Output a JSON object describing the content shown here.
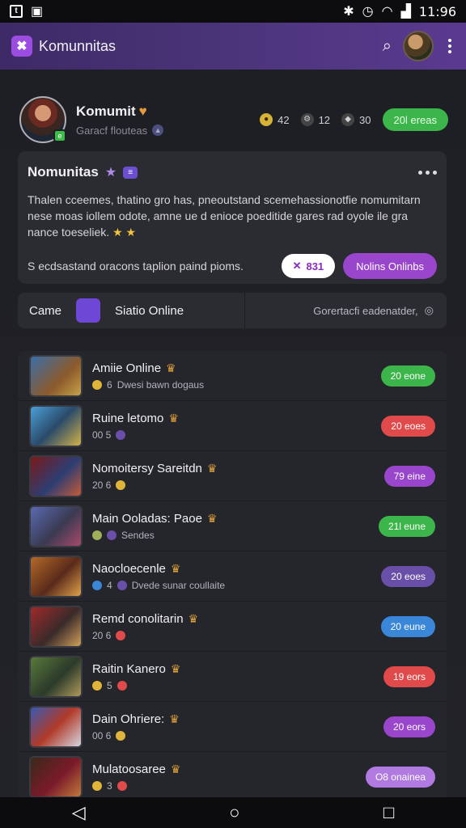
{
  "status_bar": {
    "time": "11:96"
  },
  "app_bar": {
    "title": "Komunnitas",
    "logo_glyph": "✖"
  },
  "profile": {
    "name": "Komumit",
    "subtitle": "Garacf flouteas",
    "stats": [
      "42",
      "12",
      "30"
    ],
    "pill": "20l ereas"
  },
  "card": {
    "title": "Nomunitas",
    "badge": "≡",
    "description": "Thalen cceemes, thatino gro has, pneoutstand scemehassionotfie nomumitarn nese moas iollem odote, amne ue d enioce poeditide gares rad oyole ile gra nance toeseliek.",
    "footer_text": "S ecdsastand oracons taplion paind pioms.",
    "white_pill": "831",
    "purple_pill": "Nolins Onlinbs"
  },
  "filter": {
    "left_label": "Came",
    "mid_label": "Siatio Online",
    "right_label": "Gorertacfi eadenatder,"
  },
  "rows": [
    {
      "title": "Amiie Online",
      "meta_num": "6",
      "meta_text": "Dwesi bawn dogaus",
      "pill": "20 eone",
      "pill_color": "#3cb64a",
      "thumb": "linear-gradient(135deg,#3b6ea8,#8b5a2a 60%,#c7a24a)"
    },
    {
      "title": "Ruine letomo",
      "meta_num": "00 5",
      "meta_text": "",
      "pill": "20 eoes",
      "pill_color": "#e04a4a",
      "thumb": "linear-gradient(135deg,#4aa0d8,#2a4a6a 50%,#d2b24a)"
    },
    {
      "title": "Nomoitersy Sareitdn",
      "meta_num": "20 6",
      "meta_text": "",
      "pill": "79 eine",
      "pill_color": "#9a46cc",
      "thumb": "linear-gradient(135deg,#7a1a1a,#2d3d72 55%,#c45a3a)"
    },
    {
      "title": "Main Ooladas: Paoe",
      "meta_num": "",
      "meta_text": "Sendes",
      "pill": "21l eune",
      "pill_color": "#3cb64a",
      "thumb": "linear-gradient(135deg,#5a6ab0,#3a3a52 55%,#a84a6a)"
    },
    {
      "title": "Naocloecenle",
      "meta_num": "4",
      "meta_text": "Dvede sunar coullaite",
      "pill": "20 eoes",
      "pill_color": "#6a4fa8",
      "thumb": "linear-gradient(135deg,#b36a2a,#5a2a1a 55%,#e0a24a)"
    },
    {
      "title": "Remd conolitarin",
      "meta_num": "20 6",
      "meta_text": "",
      "pill": "20 eune",
      "pill_color": "#3a86d8",
      "thumb": "linear-gradient(135deg,#a02a2a,#3a2a2a 55%,#d0a05a)"
    },
    {
      "title": "Raitin Kanero",
      "meta_num": "5",
      "meta_text": "",
      "pill": "19 eors",
      "pill_color": "#e04a4a",
      "thumb": "linear-gradient(135deg,#5a7a3a,#2a3a2a 55%,#b09a5a)"
    },
    {
      "title": "Dain Ohriere:",
      "meta_num": "00 6",
      "meta_text": "",
      "pill": "20 eors",
      "pill_color": "#9a46cc",
      "thumb": "linear-gradient(135deg,#3a5ab0,#b03a2a 50%,#d6d6e0)"
    },
    {
      "title": "Mulatoosaree",
      "meta_num": "3",
      "meta_text": "",
      "pill": "O8 onainea",
      "pill_color": "#b07ae0",
      "thumb": "linear-gradient(135deg,#3a2a1a,#7a1a2a 55%,#c07a3a)"
    }
  ]
}
